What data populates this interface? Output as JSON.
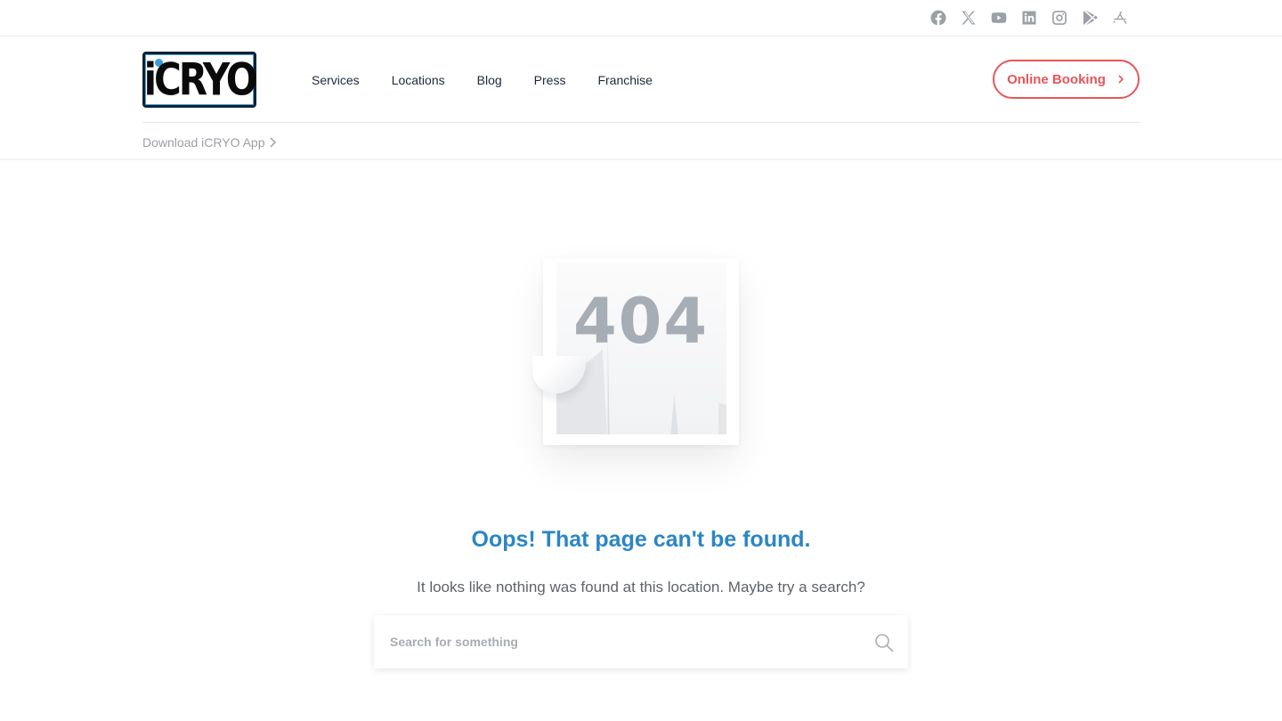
{
  "socials": [
    {
      "name": "facebook-icon"
    },
    {
      "name": "x-twitter-icon"
    },
    {
      "name": "youtube-icon"
    },
    {
      "name": "linkedin-icon"
    },
    {
      "name": "instagram-icon"
    },
    {
      "name": "google-play-icon"
    },
    {
      "name": "app-store-icon"
    }
  ],
  "logo": {
    "text": "iCRYO"
  },
  "nav": {
    "items": [
      "Services",
      "Locations",
      "Blog",
      "Press",
      "Franchise"
    ]
  },
  "booking": {
    "label": "Online Booking"
  },
  "subbar": {
    "app_link": "Download iCRYO App"
  },
  "error": {
    "code": "404",
    "title": "Oops! That page can't be found.",
    "description": "It looks like nothing was found at this location. Maybe try a search?"
  },
  "search": {
    "placeholder": "Search for something",
    "value": ""
  },
  "colors": {
    "accent": "#2b86c5",
    "booking": "#e8555a",
    "icon_gray": "#9aa0a6"
  }
}
